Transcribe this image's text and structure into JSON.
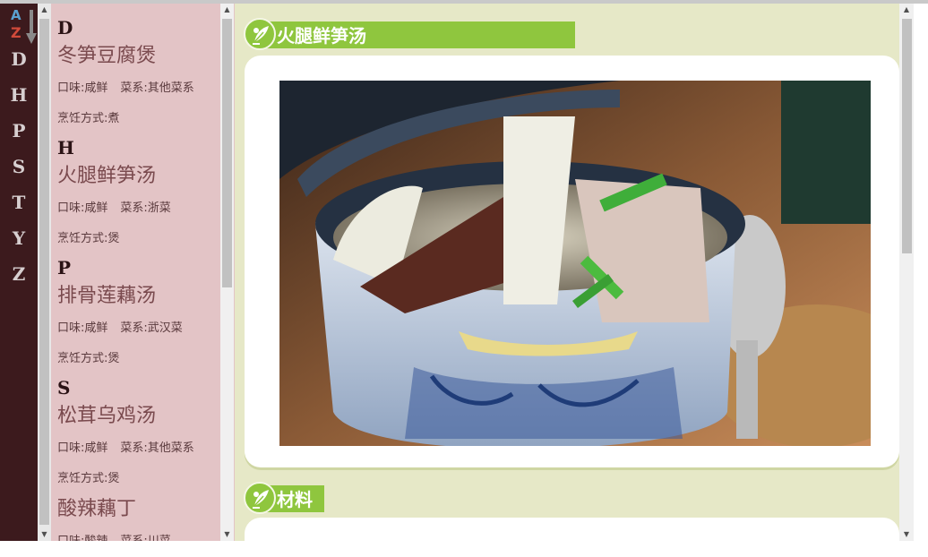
{
  "index": {
    "letters": [
      "D",
      "H",
      "P",
      "S",
      "T",
      "Y",
      "Z"
    ],
    "logo_a": "A",
    "logo_z": "Z"
  },
  "recipes": {
    "groups": [
      {
        "letter": "D",
        "items": [
          {
            "name": "冬笋豆腐煲",
            "taste": "口味:咸鲜",
            "cuisine": "菜系:其他菜系",
            "method": "烹饪方式:煮"
          }
        ]
      },
      {
        "letter": "H",
        "items": [
          {
            "name": "火腿鲜笋汤",
            "taste": "口味:咸鲜",
            "cuisine": "菜系:浙菜",
            "method": "烹饪方式:煲"
          }
        ]
      },
      {
        "letter": "P",
        "items": [
          {
            "name": "排骨莲藕汤",
            "taste": "口味:咸鲜",
            "cuisine": "菜系:武汉菜",
            "method": "烹饪方式:煲"
          }
        ]
      },
      {
        "letter": "S",
        "items": [
          {
            "name": "松茸乌鸡汤",
            "taste": "口味:咸鲜",
            "cuisine": "菜系:其他菜系",
            "method": "烹饪方式:煲"
          },
          {
            "name": "酸辣藕丁",
            "taste": "口味:酸辣",
            "cuisine": "菜系:川菜",
            "method": ""
          }
        ]
      }
    ]
  },
  "detail": {
    "title": "火腿鲜笋汤",
    "materials_heading": "材料"
  },
  "colors": {
    "rail": "#3c1a1d",
    "list_bg": "#e3c4c6",
    "main_bg": "#e6e8c7",
    "accent_green": "#8fc63e"
  },
  "icons": {
    "section_badge": "leaf-icon",
    "az_logo": "az-sort-icon"
  }
}
